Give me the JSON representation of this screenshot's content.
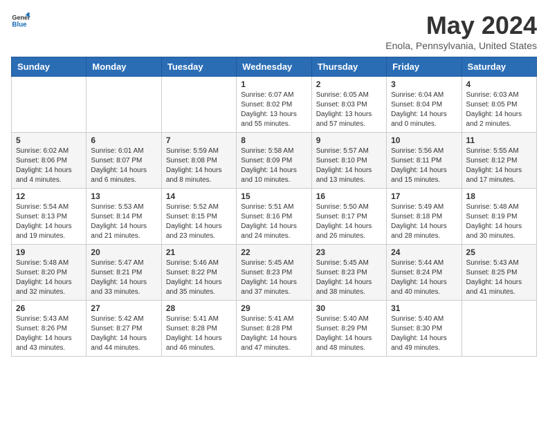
{
  "logo": {
    "general": "General",
    "blue": "Blue"
  },
  "title": "May 2024",
  "location": "Enola, Pennsylvania, United States",
  "weekdays": [
    "Sunday",
    "Monday",
    "Tuesday",
    "Wednesday",
    "Thursday",
    "Friday",
    "Saturday"
  ],
  "weeks": [
    [
      {
        "day": "",
        "sunrise": "",
        "sunset": "",
        "daylight": ""
      },
      {
        "day": "",
        "sunrise": "",
        "sunset": "",
        "daylight": ""
      },
      {
        "day": "",
        "sunrise": "",
        "sunset": "",
        "daylight": ""
      },
      {
        "day": "1",
        "sunrise": "Sunrise: 6:07 AM",
        "sunset": "Sunset: 8:02 PM",
        "daylight": "Daylight: 13 hours and 55 minutes."
      },
      {
        "day": "2",
        "sunrise": "Sunrise: 6:05 AM",
        "sunset": "Sunset: 8:03 PM",
        "daylight": "Daylight: 13 hours and 57 minutes."
      },
      {
        "day": "3",
        "sunrise": "Sunrise: 6:04 AM",
        "sunset": "Sunset: 8:04 PM",
        "daylight": "Daylight: 14 hours and 0 minutes."
      },
      {
        "day": "4",
        "sunrise": "Sunrise: 6:03 AM",
        "sunset": "Sunset: 8:05 PM",
        "daylight": "Daylight: 14 hours and 2 minutes."
      }
    ],
    [
      {
        "day": "5",
        "sunrise": "Sunrise: 6:02 AM",
        "sunset": "Sunset: 8:06 PM",
        "daylight": "Daylight: 14 hours and 4 minutes."
      },
      {
        "day": "6",
        "sunrise": "Sunrise: 6:01 AM",
        "sunset": "Sunset: 8:07 PM",
        "daylight": "Daylight: 14 hours and 6 minutes."
      },
      {
        "day": "7",
        "sunrise": "Sunrise: 5:59 AM",
        "sunset": "Sunset: 8:08 PM",
        "daylight": "Daylight: 14 hours and 8 minutes."
      },
      {
        "day": "8",
        "sunrise": "Sunrise: 5:58 AM",
        "sunset": "Sunset: 8:09 PM",
        "daylight": "Daylight: 14 hours and 10 minutes."
      },
      {
        "day": "9",
        "sunrise": "Sunrise: 5:57 AM",
        "sunset": "Sunset: 8:10 PM",
        "daylight": "Daylight: 14 hours and 13 minutes."
      },
      {
        "day": "10",
        "sunrise": "Sunrise: 5:56 AM",
        "sunset": "Sunset: 8:11 PM",
        "daylight": "Daylight: 14 hours and 15 minutes."
      },
      {
        "day": "11",
        "sunrise": "Sunrise: 5:55 AM",
        "sunset": "Sunset: 8:12 PM",
        "daylight": "Daylight: 14 hours and 17 minutes."
      }
    ],
    [
      {
        "day": "12",
        "sunrise": "Sunrise: 5:54 AM",
        "sunset": "Sunset: 8:13 PM",
        "daylight": "Daylight: 14 hours and 19 minutes."
      },
      {
        "day": "13",
        "sunrise": "Sunrise: 5:53 AM",
        "sunset": "Sunset: 8:14 PM",
        "daylight": "Daylight: 14 hours and 21 minutes."
      },
      {
        "day": "14",
        "sunrise": "Sunrise: 5:52 AM",
        "sunset": "Sunset: 8:15 PM",
        "daylight": "Daylight: 14 hours and 23 minutes."
      },
      {
        "day": "15",
        "sunrise": "Sunrise: 5:51 AM",
        "sunset": "Sunset: 8:16 PM",
        "daylight": "Daylight: 14 hours and 24 minutes."
      },
      {
        "day": "16",
        "sunrise": "Sunrise: 5:50 AM",
        "sunset": "Sunset: 8:17 PM",
        "daylight": "Daylight: 14 hours and 26 minutes."
      },
      {
        "day": "17",
        "sunrise": "Sunrise: 5:49 AM",
        "sunset": "Sunset: 8:18 PM",
        "daylight": "Daylight: 14 hours and 28 minutes."
      },
      {
        "day": "18",
        "sunrise": "Sunrise: 5:48 AM",
        "sunset": "Sunset: 8:19 PM",
        "daylight": "Daylight: 14 hours and 30 minutes."
      }
    ],
    [
      {
        "day": "19",
        "sunrise": "Sunrise: 5:48 AM",
        "sunset": "Sunset: 8:20 PM",
        "daylight": "Daylight: 14 hours and 32 minutes."
      },
      {
        "day": "20",
        "sunrise": "Sunrise: 5:47 AM",
        "sunset": "Sunset: 8:21 PM",
        "daylight": "Daylight: 14 hours and 33 minutes."
      },
      {
        "day": "21",
        "sunrise": "Sunrise: 5:46 AM",
        "sunset": "Sunset: 8:22 PM",
        "daylight": "Daylight: 14 hours and 35 minutes."
      },
      {
        "day": "22",
        "sunrise": "Sunrise: 5:45 AM",
        "sunset": "Sunset: 8:23 PM",
        "daylight": "Daylight: 14 hours and 37 minutes."
      },
      {
        "day": "23",
        "sunrise": "Sunrise: 5:45 AM",
        "sunset": "Sunset: 8:23 PM",
        "daylight": "Daylight: 14 hours and 38 minutes."
      },
      {
        "day": "24",
        "sunrise": "Sunrise: 5:44 AM",
        "sunset": "Sunset: 8:24 PM",
        "daylight": "Daylight: 14 hours and 40 minutes."
      },
      {
        "day": "25",
        "sunrise": "Sunrise: 5:43 AM",
        "sunset": "Sunset: 8:25 PM",
        "daylight": "Daylight: 14 hours and 41 minutes."
      }
    ],
    [
      {
        "day": "26",
        "sunrise": "Sunrise: 5:43 AM",
        "sunset": "Sunset: 8:26 PM",
        "daylight": "Daylight: 14 hours and 43 minutes."
      },
      {
        "day": "27",
        "sunrise": "Sunrise: 5:42 AM",
        "sunset": "Sunset: 8:27 PM",
        "daylight": "Daylight: 14 hours and 44 minutes."
      },
      {
        "day": "28",
        "sunrise": "Sunrise: 5:41 AM",
        "sunset": "Sunset: 8:28 PM",
        "daylight": "Daylight: 14 hours and 46 minutes."
      },
      {
        "day": "29",
        "sunrise": "Sunrise: 5:41 AM",
        "sunset": "Sunset: 8:28 PM",
        "daylight": "Daylight: 14 hours and 47 minutes."
      },
      {
        "day": "30",
        "sunrise": "Sunrise: 5:40 AM",
        "sunset": "Sunset: 8:29 PM",
        "daylight": "Daylight: 14 hours and 48 minutes."
      },
      {
        "day": "31",
        "sunrise": "Sunrise: 5:40 AM",
        "sunset": "Sunset: 8:30 PM",
        "daylight": "Daylight: 14 hours and 49 minutes."
      },
      {
        "day": "",
        "sunrise": "",
        "sunset": "",
        "daylight": ""
      }
    ]
  ]
}
